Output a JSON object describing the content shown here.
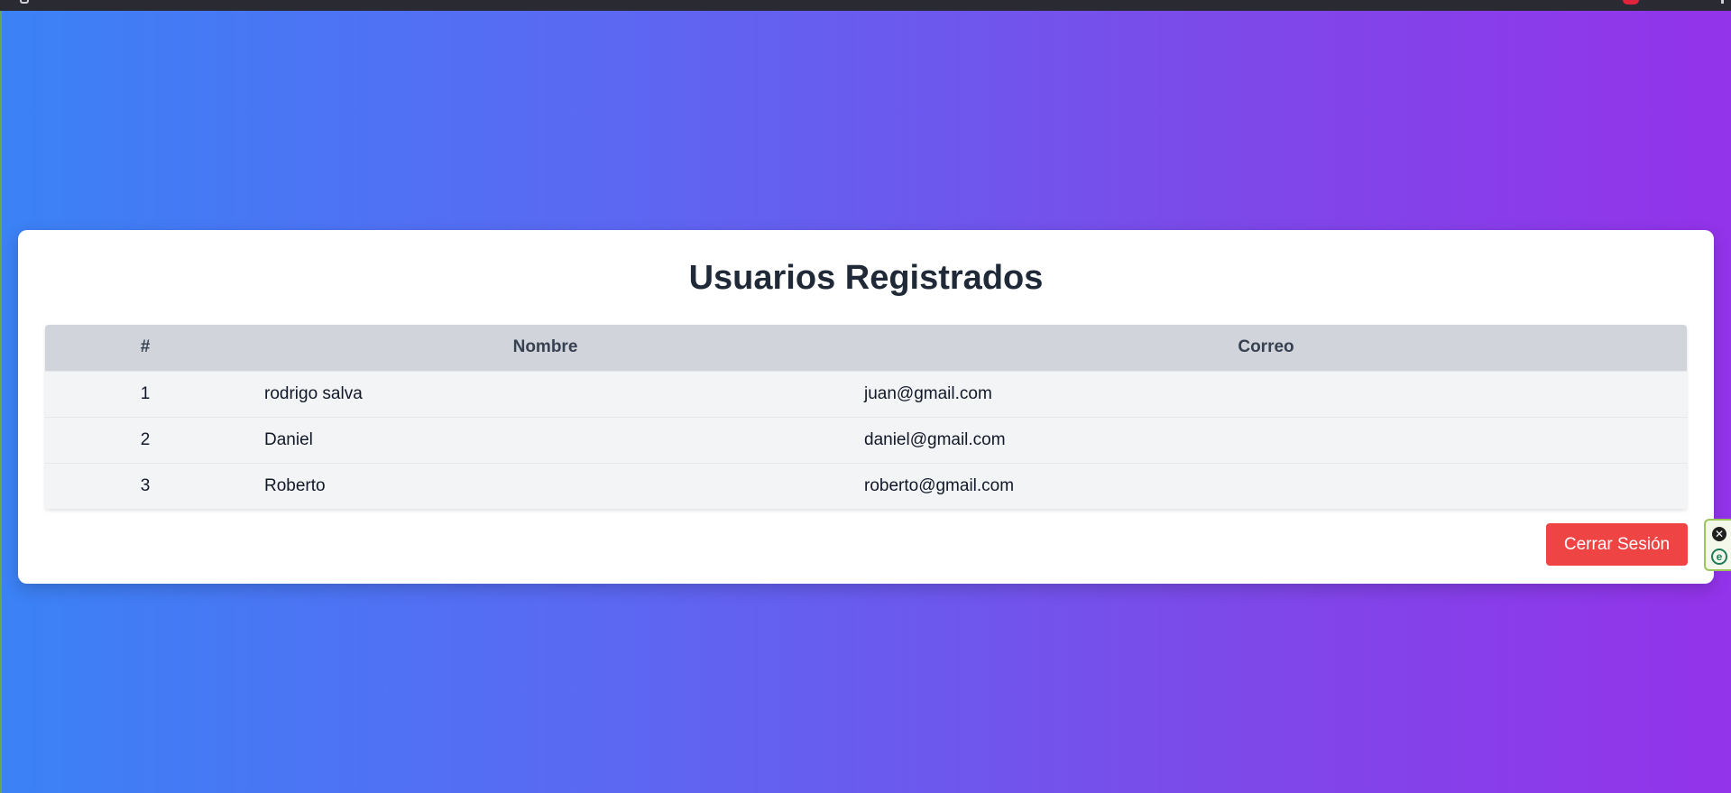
{
  "page": {
    "title": "Usuarios Registrados",
    "logout_label": "Cerrar Sesión"
  },
  "table": {
    "headers": {
      "num": "#",
      "name": "Nombre",
      "email": "Correo"
    },
    "rows": [
      {
        "num": "1",
        "name": "rodrigo salva",
        "email": "juan@gmail.com"
      },
      {
        "num": "2",
        "name": "Daniel",
        "email": "daniel@gmail.com"
      },
      {
        "num": "3",
        "name": "Roberto",
        "email": "roberto@gmail.com"
      }
    ]
  },
  "extension": {
    "close_icon": "close-circle-icon",
    "logo_icon": "extension-logo-icon",
    "close_glyph": "✕",
    "logo_glyph": "e"
  },
  "colors": {
    "gradient_start": "#3b82f6",
    "gradient_end": "#9333ea",
    "logout_button": "#ef4444",
    "table_header": "#d1d5db",
    "table_row": "#f3f4f6"
  }
}
